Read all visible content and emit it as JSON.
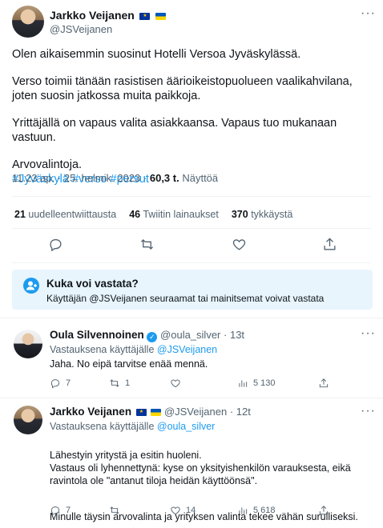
{
  "main_tweet": {
    "author_name": "Jarkko Veijanen",
    "author_handle": "@JSVeijanen",
    "more_icon": "···",
    "paragraphs": [
      "Olen aikaisemmin suosinut Hotelli Versoa Jyväskylässä.",
      "Verso toimii tänään rasistisen äärioikeistopuolueen vaalikahvilana, joten suosin jatkossa muita paikkoja.",
      "Yrittäjällä on vapaus valita asiakkaansa. Vapaus tuo mukanaan vastuun."
    ],
    "closing_line": "Arvovalintoja.",
    "hashtags": [
      "#Jyväskylä",
      "#verso",
      "#persut"
    ],
    "time": "11.23 ap.",
    "separator": "·",
    "date": "25. helmik. 2023",
    "views_count": "60,3 t.",
    "views_label": "Näyttöä",
    "stats": {
      "retweets_count": "21",
      "retweets_label": "uudelleentwiittausta",
      "quotes_count": "46",
      "quotes_label": "Twiitin lainaukset",
      "likes_count": "370",
      "likes_label": "tykkäystä"
    }
  },
  "reply_restriction": {
    "title": "Kuka voi vastata?",
    "subtitle": "Käyttäjän @JSVeijanen seuraamat tai mainitsemat voivat vastata"
  },
  "replies": [
    {
      "author_name": "Oula Silvennoinen",
      "author_handle": "@oula_silver",
      "time": "13t",
      "reply_prefix": "Vastauksena käyttäjälle",
      "reply_to": "@JSVeijanen",
      "body": [
        "Jaha. No eipä tarvitse enää mennä."
      ],
      "counts": {
        "replies": "7",
        "retweets": "1",
        "likes": "",
        "views": "5 130"
      }
    },
    {
      "author_name": "Jarkko Veijanen",
      "author_handle": "@JSVeijanen",
      "time": "12t",
      "reply_prefix": "Vastauksena käyttäjälle",
      "reply_to": "@oula_silver",
      "body": [
        "Lähestyin yritystä ja esitin huoleni.\nVastaus oli lyhennettynä: kyse on yksityishenkilön varauksesta, eikä ravintola ole \"antanut tiloja heidän käyttöönsä\".",
        "Minulle täysin arvovalinta ja yrityksen valinta tekee vähän surulliseksi."
      ],
      "counts": {
        "replies": "7",
        "retweets": "",
        "likes": "14",
        "views": "5 618"
      }
    }
  ],
  "icons": {
    "reply": "reply-icon",
    "retweet": "retweet-icon",
    "like": "heart-icon",
    "bookmark": "bookmark-icon",
    "share": "share-icon",
    "views": "views-icon",
    "people": "people-icon"
  },
  "colors": {
    "accent": "#1d9bf0",
    "text": "#0f1419",
    "muted": "#536471",
    "restriction_bg": "#e8f5fd"
  }
}
